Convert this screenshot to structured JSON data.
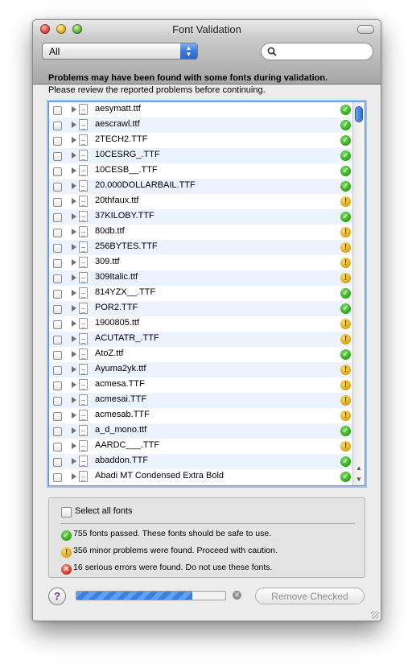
{
  "window": {
    "title": "Font Validation"
  },
  "toolbar": {
    "filter_value": "All",
    "search_placeholder": ""
  },
  "header": {
    "heading": "Problems may have been found with some fonts during validation.",
    "subheading": "Please review the reported problems before continuing."
  },
  "fonts": [
    {
      "name": "aesymatt.ttf",
      "status": "pass"
    },
    {
      "name": "aescrawl.ttf",
      "status": "pass"
    },
    {
      "name": "2TECH2.TTF",
      "status": "pass"
    },
    {
      "name": "10CESRG_.TTF",
      "status": "pass"
    },
    {
      "name": "10CESB__.TTF",
      "status": "pass"
    },
    {
      "name": "20.000DOLLARBAIL.TTF",
      "status": "pass"
    },
    {
      "name": "20thfaux.ttf",
      "status": "warn"
    },
    {
      "name": "37KILOBY.TTF",
      "status": "pass"
    },
    {
      "name": "80db.ttf",
      "status": "warn"
    },
    {
      "name": "256BYTES.TTF",
      "status": "warn"
    },
    {
      "name": "309.ttf",
      "status": "warn"
    },
    {
      "name": "309Italic.ttf",
      "status": "warn"
    },
    {
      "name": "814YZX__.TTF",
      "status": "pass"
    },
    {
      "name": "POR2.TTF",
      "status": "pass"
    },
    {
      "name": "1900805.ttf",
      "status": "warn"
    },
    {
      "name": "ACUTATR_.TTF",
      "status": "warn"
    },
    {
      "name": "AtoZ.ttf",
      "status": "pass"
    },
    {
      "name": "Ayuma2yk.ttf",
      "status": "warn"
    },
    {
      "name": "acmesa.TTF",
      "status": "warn"
    },
    {
      "name": "acmesai.TTF",
      "status": "warn"
    },
    {
      "name": "acmesab.TTF",
      "status": "warn"
    },
    {
      "name": "a_d_mono.ttf",
      "status": "pass"
    },
    {
      "name": "AARDC___.TTF",
      "status": "warn"
    },
    {
      "name": "abaddon.TTF",
      "status": "pass"
    },
    {
      "name": "Abadi MT Condensed Extra Bold",
      "status": "pass"
    }
  ],
  "summary": {
    "select_all_label": "Select all fonts",
    "passed": "755 fonts passed. These fonts should be safe to use.",
    "minor": "356 minor problems were found. Proceed with caution.",
    "serious": "16 serious errors were found. Do not use these fonts."
  },
  "footer": {
    "help_label": "?",
    "progress_fraction": 0.78,
    "remove_label": "Remove Checked"
  },
  "icons": {
    "pass": "check-icon",
    "warn": "exclamation-icon",
    "error": "x-icon"
  },
  "colors": {
    "pass": "#2ea315",
    "warn": "#d9a008",
    "error": "#d0291a",
    "accent": "#3a80df"
  }
}
